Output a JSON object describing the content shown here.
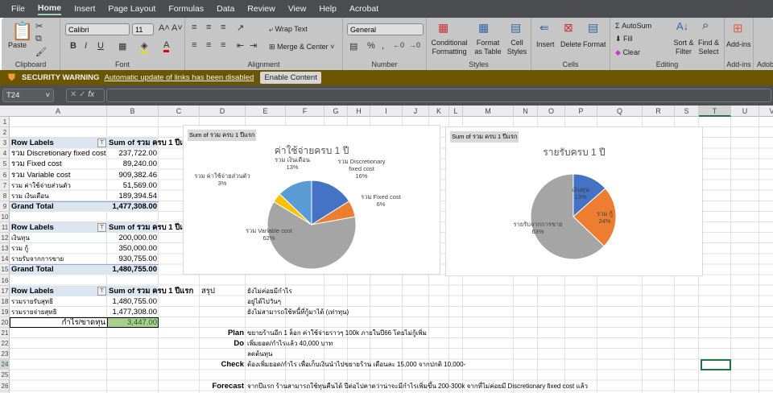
{
  "ribbon_tabs": [
    "File",
    "Home",
    "Insert",
    "Page Layout",
    "Formulas",
    "Data",
    "Review",
    "View",
    "Help",
    "Acrobat"
  ],
  "active_tab": "Home",
  "ribbon": {
    "paste": "Paste",
    "clipboard": "Clipboard",
    "font_name": "Calibri",
    "font_size": "11",
    "font": "Font",
    "wrap_text": "Wrap Text",
    "merge_center": "Merge & Center",
    "alignment": "Alignment",
    "number_format": "General",
    "number": "Number",
    "conditional_formatting": "Conditional Formatting",
    "format_as_table": "Format as Table",
    "cell_styles": "Cell Styles",
    "styles": "Styles",
    "insert": "Insert",
    "delete": "Delete",
    "format": "Format",
    "cells": "Cells",
    "autosum": "AutoSum",
    "fill": "Fill",
    "clear": "Clear",
    "sort_filter": "Sort & Filter",
    "find_select": "Find & Select",
    "editing": "Editing",
    "addins": "Add-ins",
    "addins_group": "Add-ins",
    "adobe_group": "Adob"
  },
  "security": {
    "title": "SECURITY WARNING",
    "message": "Automatic update of links has been disabled",
    "button": "Enable Content"
  },
  "formula_bar": {
    "name_box": "T24",
    "fx": "fx",
    "value": ""
  },
  "columns": [
    "A",
    "B",
    "C",
    "D",
    "E",
    "F",
    "G",
    "H",
    "I",
    "J",
    "K",
    "L",
    "M",
    "N",
    "O",
    "P",
    "Q",
    "R",
    "S",
    "T",
    "U",
    "V"
  ],
  "selected_column": "T",
  "selected_row": 24,
  "rows": [
    1,
    2,
    3,
    4,
    5,
    6,
    7,
    8,
    9,
    10,
    11,
    12,
    13,
    14,
    15,
    16,
    17,
    18,
    19,
    20,
    21,
    22,
    23,
    24,
    25,
    26
  ],
  "cells": [
    {
      "c": "A",
      "r": 3,
      "v": "Row Labels",
      "s": "b"
    },
    {
      "c": "B",
      "r": 3,
      "v": "Sum of รวม ครบ 1 ปีแรก",
      "s": "b"
    },
    {
      "c": "A",
      "r": 4,
      "v": "รวม Discretionary fixed cost"
    },
    {
      "c": "B",
      "r": 4,
      "v": "237,722.00",
      "s": "r"
    },
    {
      "c": "A",
      "r": 5,
      "v": "รวม Fixed cost"
    },
    {
      "c": "B",
      "r": 5,
      "v": "89,240.00",
      "s": "r"
    },
    {
      "c": "A",
      "r": 6,
      "v": "รวม Variable cost"
    },
    {
      "c": "B",
      "r": 6,
      "v": "909,382.46",
      "s": "r"
    },
    {
      "c": "A",
      "r": 7,
      "v": "รวม ค่าใช้จ่ายส่วนตัว"
    },
    {
      "c": "B",
      "r": 7,
      "v": "51,569.00",
      "s": "r"
    },
    {
      "c": "A",
      "r": 8,
      "v": "รวม เงินเดือน"
    },
    {
      "c": "B",
      "r": 8,
      "v": "189,394.54",
      "s": "r"
    },
    {
      "c": "A",
      "r": 9,
      "v": "Grand Total",
      "s": "b"
    },
    {
      "c": "B",
      "r": 9,
      "v": "1,477,308.00",
      "s": "b r"
    },
    {
      "c": "A",
      "r": 11,
      "v": "Row Labels",
      "s": "b"
    },
    {
      "c": "B",
      "r": 11,
      "v": "Sum of รวม ครบ 1 ปีแรก",
      "s": "b"
    },
    {
      "c": "A",
      "r": 12,
      "v": "เงินทุน"
    },
    {
      "c": "B",
      "r": 12,
      "v": "200,000.00",
      "s": "r"
    },
    {
      "c": "A",
      "r": 13,
      "v": "รวม กู้"
    },
    {
      "c": "B",
      "r": 13,
      "v": "350,000.00",
      "s": "r"
    },
    {
      "c": "A",
      "r": 14,
      "v": "รายรับจากการขาย"
    },
    {
      "c": "B",
      "r": 14,
      "v": "930,755.00",
      "s": "r"
    },
    {
      "c": "A",
      "r": 15,
      "v": "Grand Total",
      "s": "b"
    },
    {
      "c": "B",
      "r": 15,
      "v": "1,480,755.00",
      "s": "b r"
    },
    {
      "c": "A",
      "r": 17,
      "v": "Row Labels",
      "s": "b"
    },
    {
      "c": "B",
      "r": 17,
      "v": "Sum of รวม ครบ 1 ปีแรก",
      "s": "b"
    },
    {
      "c": "A",
      "r": 18,
      "v": "รวมรายรับสุทธิ"
    },
    {
      "c": "B",
      "r": 18,
      "v": "1,480,755.00",
      "s": "r"
    },
    {
      "c": "A",
      "r": 19,
      "v": "รวมรายจ่ายสุทธิ"
    },
    {
      "c": "B",
      "r": 19,
      "v": "1,477,308.00",
      "s": "r"
    },
    {
      "c": "A",
      "r": 20,
      "v": "กำไร/ขาดทุน",
      "s": "r"
    },
    {
      "c": "B",
      "r": 20,
      "v": "3,447.00",
      "s": "r"
    },
    {
      "c": "D",
      "r": 17,
      "v": "สรุป"
    },
    {
      "c": "E",
      "r": 17,
      "v": "ยังไม่ค่อยมีกำไร"
    },
    {
      "c": "E",
      "r": 18,
      "v": "อยู่ได้ไปวันๆ"
    },
    {
      "c": "E",
      "r": 19,
      "v": "ยังไม่สามารถใช้หนี้ที่กู้มาได้ (เท่าทุน)"
    },
    {
      "c": "D",
      "r": 21,
      "v": "Plan",
      "s": "b r"
    },
    {
      "c": "E",
      "r": 21,
      "v": "ขยายร้านอีก 1 ล็อก ค่าใช้จ่ายราวๆ 100k ภายในปี66 โดยไม่กู้เพิ่ม"
    },
    {
      "c": "D",
      "r": 22,
      "v": "Do",
      "s": "b r"
    },
    {
      "c": "E",
      "r": 22,
      "v": "เพิ่มยอด/กำไรแล้ว 40,000 บาท"
    },
    {
      "c": "E",
      "r": 23,
      "v": "ลดต้นทุน"
    },
    {
      "c": "D",
      "r": 24,
      "v": "Check",
      "s": "b r"
    },
    {
      "c": "E",
      "r": 24,
      "v": "ต้องเพิ่มยอด/กำไร เพื่อเก็บเงินนำไปขยายร้าน เดือนละ 15,000 จากปกติ 10,000-"
    },
    {
      "c": "D",
      "r": 26,
      "v": "Forecast",
      "s": "b r"
    },
    {
      "c": "E",
      "r": 26,
      "v": "จากปีแรก ร้านสามารถใช้ทุนคืนได้ ปีต่อไปคาดว่าน่าจะมีกำไรเพิ่มขึ้น 200-300k จากที่ไม่ค่อยมี Discretionary fixed cost แล้ว"
    }
  ],
  "chart_data": [
    {
      "type": "pie",
      "tag": "Sum of รวม ครบ 1 ปีแรก",
      "title": "ค่าใช้จ่ายครบ 1 ปี",
      "slices": [
        {
          "label": "รวม Discretionary fixed cost",
          "value": 237722.0,
          "pct": "16%",
          "color": "#4472c4"
        },
        {
          "label": "รวม Fixed cost",
          "value": 89240.0,
          "pct": "6%",
          "color": "#ed7d31"
        },
        {
          "label": "รวม Variable cost",
          "value": 909382.46,
          "pct": "62%",
          "color": "#a5a5a5"
        },
        {
          "label": "รวม ค่าใช้จ่ายส่วนตัว",
          "value": 51569.0,
          "pct": "3%",
          "color": "#ffc000"
        },
        {
          "label": "รวม เงินเดือน",
          "value": 189394.54,
          "pct": "13%",
          "color": "#5b9bd5"
        }
      ]
    },
    {
      "type": "pie",
      "tag": "Sum of รวม ครบ 1 ปีแรก",
      "title": "รายรับครบ 1 ปี",
      "slices": [
        {
          "label": "เงินทุน",
          "value": 200000,
          "pct": "13%",
          "color": "#4472c4"
        },
        {
          "label": "รวม กู้",
          "value": 350000,
          "pct": "24%",
          "color": "#ed7d31"
        },
        {
          "label": "รายรับจากการขาย",
          "value": 930755,
          "pct": "63%",
          "color": "#a5a5a5"
        }
      ]
    }
  ]
}
